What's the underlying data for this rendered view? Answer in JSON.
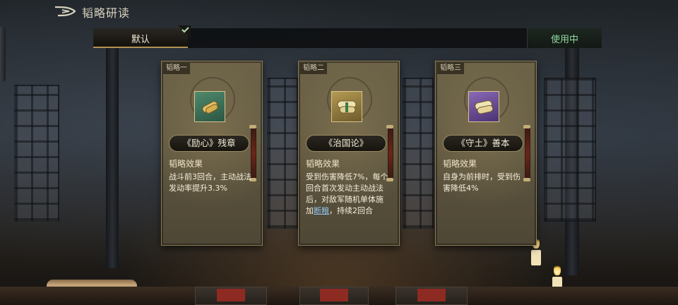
{
  "header": {
    "title": "韬略研读"
  },
  "scheme_bar": {
    "active_tab": "默认",
    "status": "使用中"
  },
  "cards": [
    {
      "tag": "韬略一",
      "icon": "scroll-green-icon",
      "name": "《励心》残章",
      "effect_heading": "韬略效果",
      "effect_text": "战斗前3回合，主动战法发动率提升3.3%"
    },
    {
      "tag": "韬略二",
      "icon": "scroll-gold-icon",
      "name": "《治国论》",
      "effect_heading": "韬略效果",
      "effect_text_before": "受到伤害降低7%，每个回合首次发动主动战法后，对敌军随机单体施加",
      "effect_link": "断粮",
      "effect_text_after": "，持续2回合"
    },
    {
      "tag": "韬略三",
      "icon": "scroll-purple-icon",
      "name": "《守土》善本",
      "effect_heading": "韬略效果",
      "effect_text": "自身为前排时，受到伤害降低4%"
    }
  ],
  "colors": {
    "in_use_text": "#8fd9a2",
    "link_text": "#8fc1f0",
    "card_bg": "#5d5540",
    "tab_accent": "#b39253"
  }
}
